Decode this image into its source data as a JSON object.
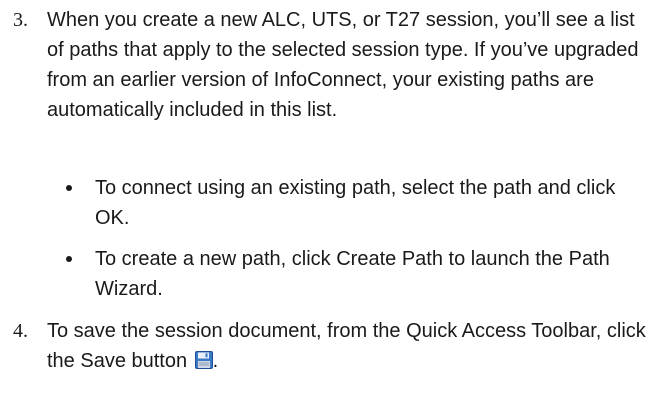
{
  "steps": [
    {
      "number": "3.",
      "text": "When you create a new ALC, UTS, or T27 session, you’ll see a list of paths that apply to the selected session type. If you’ve upgraded from an earlier version of InfoConnect, your existing paths are automatically included in this list."
    },
    {
      "number": "4.",
      "text": "To save the session document, from the Quick Access Toolbar, click the Save button",
      "trailing": "."
    }
  ],
  "bullets": [
    "To connect using an existing path, select the path and click OK.",
    "To create a new path, click Create Path to launch the Path Wizard."
  ],
  "icons": {
    "save": "save-icon"
  }
}
